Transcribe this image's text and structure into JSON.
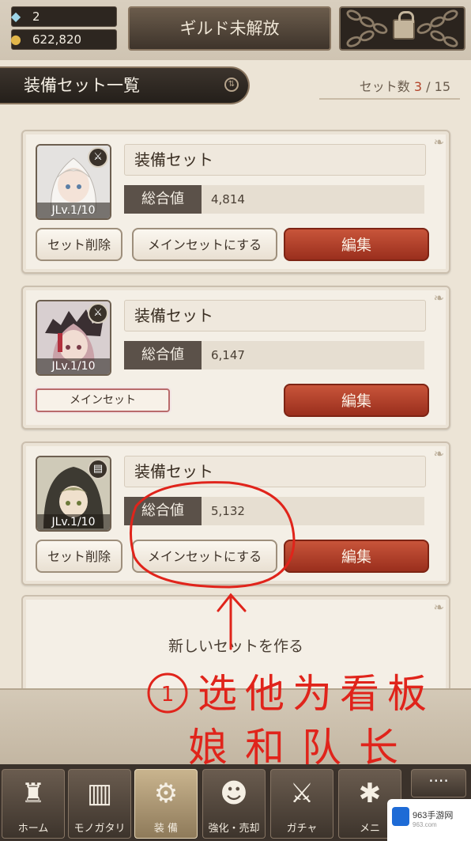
{
  "status": {
    "gems": "2",
    "gold": "622,820",
    "gem_icon": "crystal-icon",
    "gold_icon": "coin-icon"
  },
  "guild_button_label": "ギルド未解放",
  "section": {
    "title": "装備セット一覧",
    "count_label": "セット数",
    "count_current": "3",
    "count_separator": " / ",
    "count_max": "15"
  },
  "cards": [
    {
      "level": "JLv.1/10",
      "name": "装備セット",
      "total_label": "総合値",
      "total_value": "4,814",
      "delete_label": "セット削除",
      "main_label": "メインセットにする",
      "edit_label": "編集"
    },
    {
      "level": "JLv.1/10",
      "name": "装備セット",
      "total_label": "総合値",
      "total_value": "6,147",
      "main_tag": "メインセット",
      "edit_label": "編集"
    },
    {
      "level": "JLv.1/10",
      "name": "装備セット",
      "total_label": "総合値",
      "total_value": "5,132",
      "delete_label": "セット削除",
      "main_label": "メインセットにする",
      "edit_label": "編集"
    }
  ],
  "new_set_label": "新しいセットを作る",
  "annotation": {
    "number": "1",
    "line1": "选他为看板",
    "line2": "娘和队长",
    "color": "#e0241b"
  },
  "nav": [
    {
      "label": "ホーム",
      "icon": "castle-icon"
    },
    {
      "label": "モノガタリ",
      "icon": "book-icon"
    },
    {
      "label": "装 備",
      "icon": "equipment-icon"
    },
    {
      "label": "強化・売却",
      "icon": "mask-icon"
    },
    {
      "label": "ガチャ",
      "icon": "swords-icon"
    },
    {
      "label": "メニ",
      "icon": "gear-icon"
    }
  ],
  "more_label": "····",
  "watermark": {
    "name": "963手游网",
    "url": "963.com"
  }
}
